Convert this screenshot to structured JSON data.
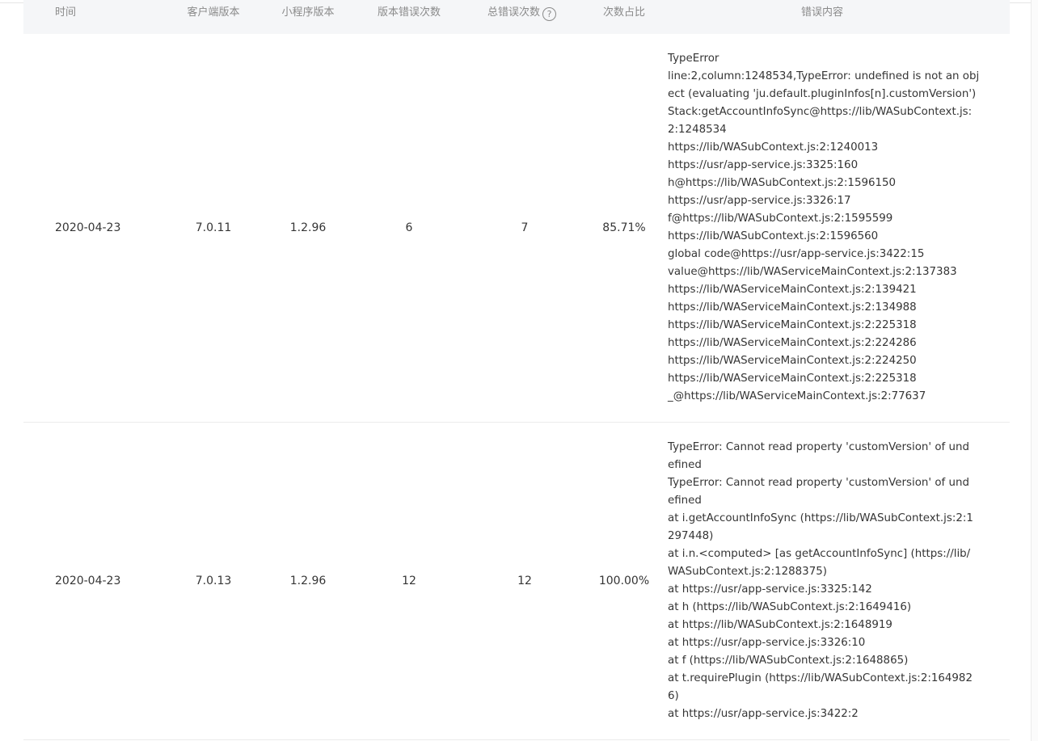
{
  "columns": {
    "time": "时间",
    "client_version": "客户端版本",
    "app_version": "小程序版本",
    "version_errors": "版本错误次数",
    "total_errors": "总错误次数",
    "ratio": "次数占比",
    "content": "错误内容"
  },
  "rows": [
    {
      "time": "2020-04-23",
      "client_version": "7.0.11",
      "app_version": "1.2.96",
      "version_errors": "6",
      "total_errors": "7",
      "ratio": "85.71%",
      "lines": [
        "TypeError",
        "line:2,column:1248534,TypeError: undefined is not an obj",
        "ect (evaluating 'ju.default.pluginInfos[n].customVersion')",
        "Stack:getAccountInfoSync@https://lib/WASubContext.js:",
        "2:1248534",
        "https://lib/WASubContext.js:2:1240013",
        "https://usr/app-service.js:3325:160",
        "h@https://lib/WASubContext.js:2:1596150",
        "https://usr/app-service.js:3326:17",
        "f@https://lib/WASubContext.js:2:1595599",
        "https://lib/WASubContext.js:2:1596560",
        "global code@https://usr/app-service.js:3422:15",
        "value@https://lib/WAServiceMainContext.js:2:137383",
        "https://lib/WAServiceMainContext.js:2:139421",
        "https://lib/WAServiceMainContext.js:2:134988",
        "https://lib/WAServiceMainContext.js:2:225318",
        "https://lib/WAServiceMainContext.js:2:224286",
        "https://lib/WAServiceMainContext.js:2:224250",
        "https://lib/WAServiceMainContext.js:2:225318",
        "_@https://lib/WAServiceMainContext.js:2:77637"
      ]
    },
    {
      "time": "2020-04-23",
      "client_version": "7.0.13",
      "app_version": "1.2.96",
      "version_errors": "12",
      "total_errors": "12",
      "ratio": "100.00%",
      "lines": [
        "TypeError: Cannot read property 'customVersion' of und",
        "efined",
        "TypeError: Cannot read property 'customVersion' of und",
        "efined",
        "at i.getAccountInfoSync (https://lib/WASubContext.js:2:1",
        "297448)",
        "at i.n.<computed> [as getAccountInfoSync] (https://lib/",
        "WASubContext.js:2:1288375)",
        "at https://usr/app-service.js:3325:142",
        "at h (https://lib/WASubContext.js:2:1649416)",
        "at https://lib/WASubContext.js:2:1648919",
        "at https://usr/app-service.js:3326:10",
        "at f (https://lib/WASubContext.js:2:1648865)",
        "at t.requirePlugin (https://lib/WASubContext.js:2:164982",
        "6)",
        "at https://usr/app-service.js:3422:2"
      ]
    }
  ]
}
